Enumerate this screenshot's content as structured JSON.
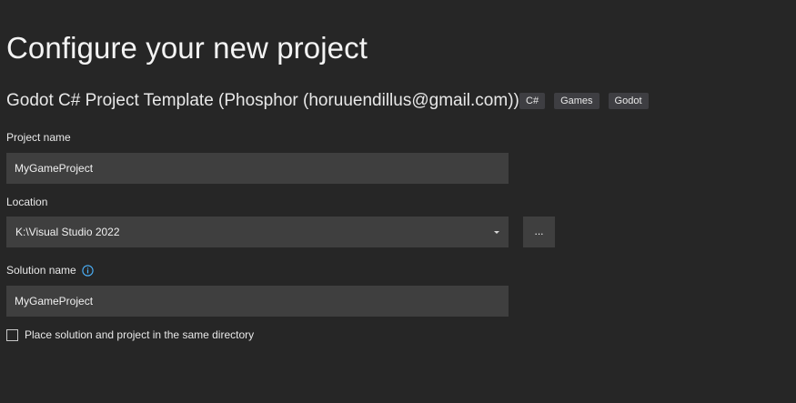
{
  "page_title": "Configure your new project",
  "template": {
    "name": "Godot C# Project Template (Phosphor (horuuendillus@gmail.com))",
    "tags": [
      "C#",
      "Games",
      "Godot"
    ]
  },
  "project_name": {
    "label": "Project name",
    "value": "MyGameProject"
  },
  "location": {
    "label": "Location",
    "value": "K:\\Visual Studio 2022",
    "browse_label": "..."
  },
  "solution_name": {
    "label": "Solution name",
    "value": "MyGameProject"
  },
  "same_directory": {
    "label": "Place solution and project in the same directory",
    "checked": false
  },
  "colors": {
    "background": "#262626",
    "input_background": "#3f3f3f",
    "tag_background": "#3e3e42",
    "info_icon": "#4cb4ff"
  }
}
